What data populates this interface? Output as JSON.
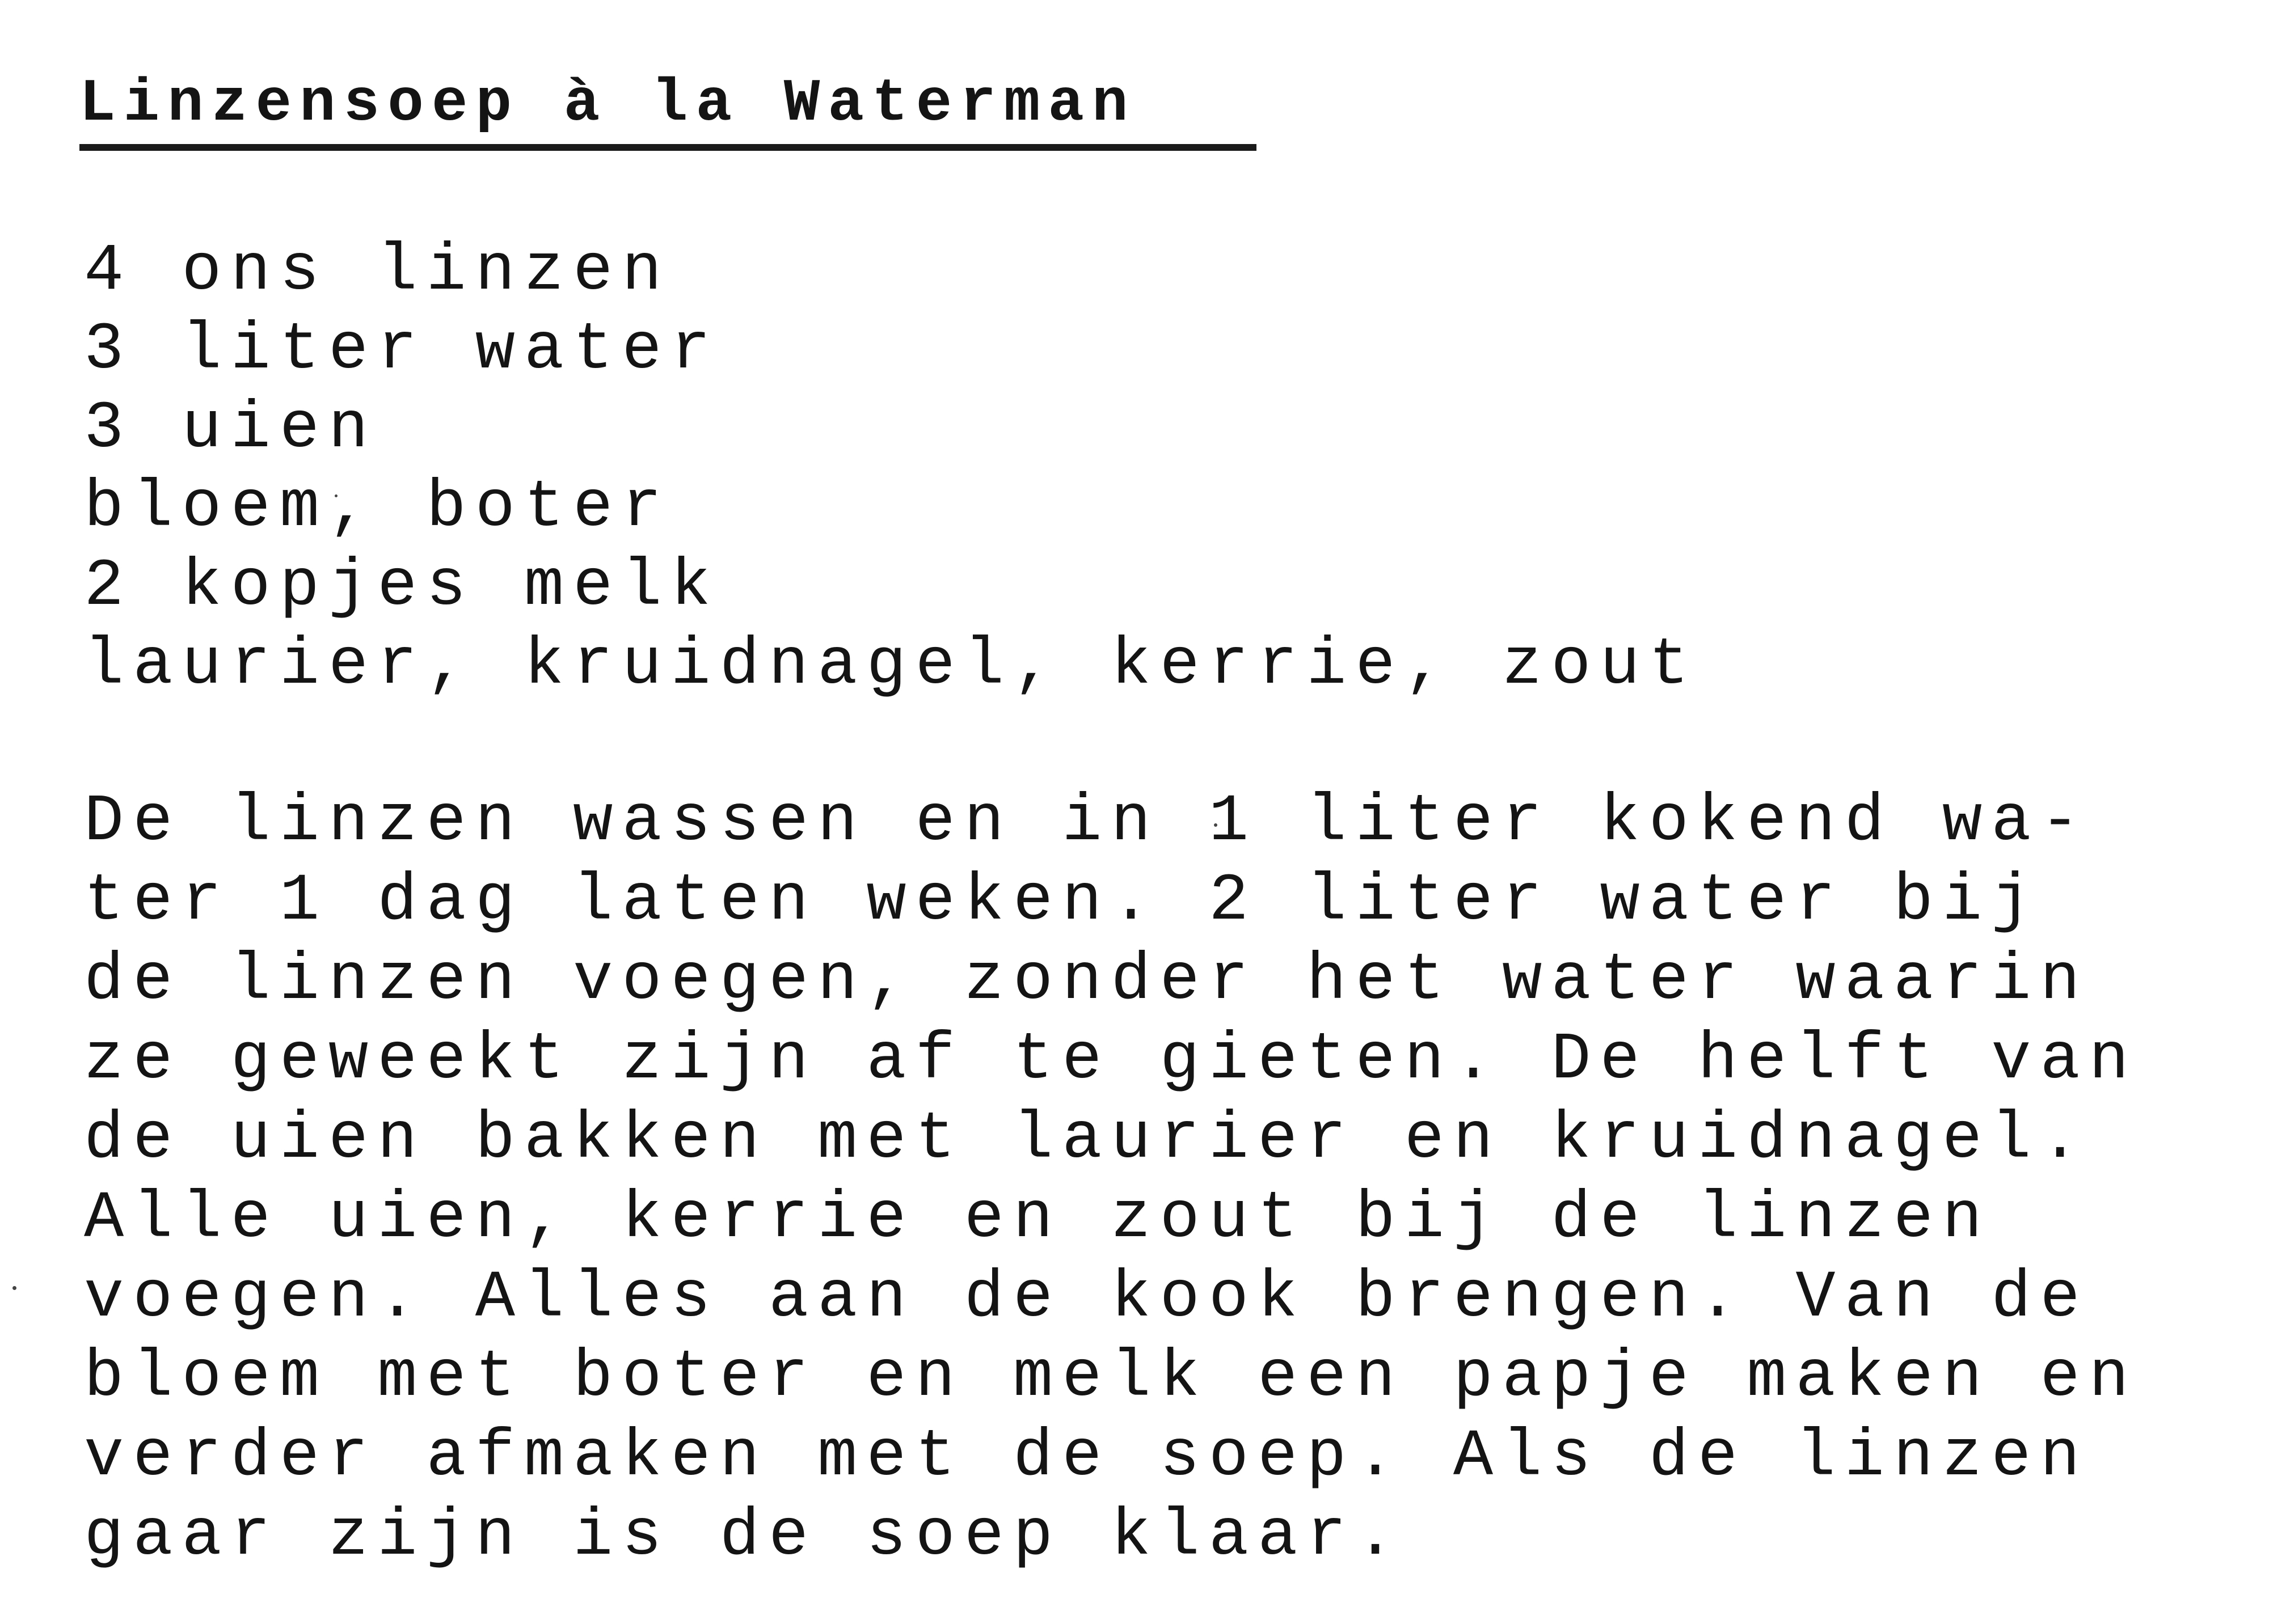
{
  "recipe": {
    "title": "Linzensoep à la Waterman",
    "ingredients": [
      "4 ons linzen",
      "3 liter water",
      "3 uien",
      "bloem, boter",
      "2 kopjes melk",
      "laurier, kruidnagel, kerrie, zout"
    ],
    "method_lines": [
      "De linzen wassen en in 1 liter kokend wa-",
      "ter 1 dag laten weken. 2 liter water bij",
      "de linzen voegen, zonder het water waarin",
      "ze geweekt zijn af te gieten. De helft van",
      "de uien bakken met laurier en kruidnagel.",
      "Alle uien, kerrie en zout bij de linzen",
      "voegen. Alles aan de kook brengen. Van de",
      "bloem met boter en melk een papje maken en",
      "verder afmaken met de soep. Als de linzen",
      "gaar zijn is de soep klaar."
    ]
  }
}
